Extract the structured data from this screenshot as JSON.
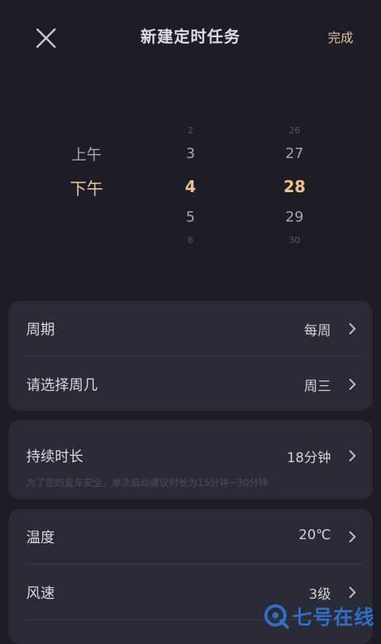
{
  "header": {
    "title": "新建定时任务",
    "done_label": "完成"
  },
  "picker": {
    "ampm": {
      "above": "上午",
      "selected": "下午"
    },
    "hours": [
      "2",
      "3",
      "4",
      "5",
      "6"
    ],
    "minutes": [
      "26",
      "27",
      "28",
      "29",
      "30"
    ]
  },
  "card1": {
    "cycle": {
      "label": "周期",
      "value": "每周"
    },
    "weekday": {
      "label": "请选择周几",
      "value": "周三"
    }
  },
  "card2": {
    "duration": {
      "label": "持续时长",
      "value": "18分钟"
    },
    "hint": "为了您的爱车安全，单次启动建议时长为15分钟~30分钟"
  },
  "card3": {
    "temperature": {
      "label": "温度",
      "value": "20℃"
    },
    "fan": {
      "label": "风速",
      "value": "3级"
    }
  },
  "watermark": {
    "text": "七号在线"
  },
  "colors": {
    "background": "#1d1d28",
    "card": "#2a2b37",
    "accent": "#edc28b",
    "watermark": "#2f6fc8"
  }
}
